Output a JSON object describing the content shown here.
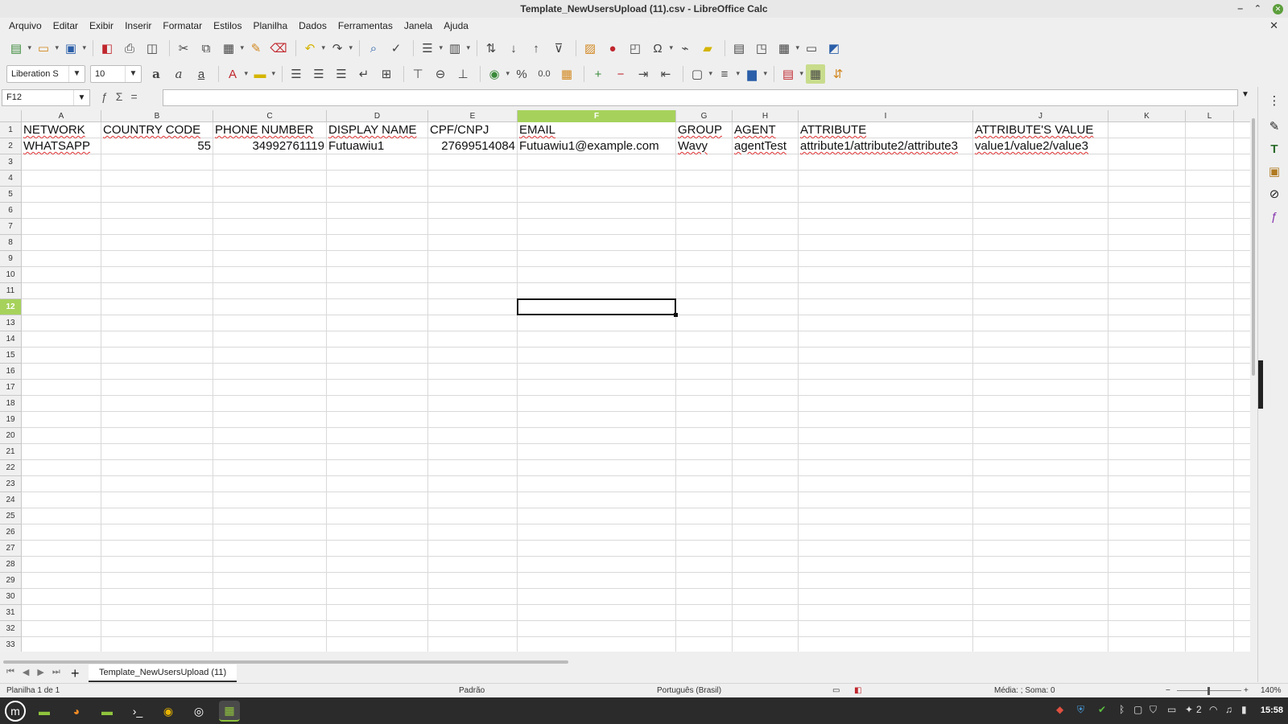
{
  "window": {
    "title": "Template_NewUsersUpload (11).csv - LibreOffice Calc",
    "min_label": "‒",
    "max_label": "⌃",
    "close_label": "✕",
    "doc_close_label": "✕"
  },
  "menu": [
    "Arquivo",
    "Editar",
    "Exibir",
    "Inserir",
    "Formatar",
    "Estilos",
    "Planilha",
    "Dados",
    "Ferramentas",
    "Janela",
    "Ajuda"
  ],
  "toolbar": {
    "font_name": "Liberation S",
    "font_size": "10",
    "percent_label": "%",
    "decimal_label": "0.0",
    "omega_label": "Ω"
  },
  "formula_bar": {
    "name_box": "F12",
    "sum_label": "Σ",
    "equals_label": "=",
    "content": ""
  },
  "grid": {
    "columns": [
      "A",
      "B",
      "C",
      "D",
      "E",
      "F",
      "G",
      "H",
      "I",
      "J",
      "K",
      "L"
    ],
    "selected_column": "F",
    "selected_row": "12",
    "rows": [
      "1",
      "2",
      "3",
      "4",
      "5",
      "6",
      "7",
      "8",
      "9",
      "10",
      "11",
      "12",
      "13",
      "14",
      "15",
      "16",
      "17",
      "18",
      "19",
      "20",
      "21",
      "22",
      "23",
      "24",
      "25",
      "26",
      "27",
      "28",
      "29",
      "30",
      "31",
      "32",
      "33"
    ],
    "header_row": [
      "NETWORK",
      "COUNTRY CODE",
      "PHONE NUMBER",
      "DISPLAY NAME",
      "CPF/CNPJ",
      "EMAIL",
      "GROUP",
      "AGENT",
      "ATTRIBUTE",
      "ATTRIBUTE'S VALUE"
    ],
    "data_row": [
      "WHATSAPP",
      "55",
      "34992761119",
      "Futuawiu1",
      "27699514084",
      "Futuawiu1@example.com",
      "Wavy",
      "agentTest",
      "attribute1/attribute2/attribute3",
      "value1/value2/value3"
    ]
  },
  "sheets": {
    "add_label": "+",
    "active_tab": "Template_NewUsersUpload (11)"
  },
  "status": {
    "sheet_info": "Planilha 1 de 1",
    "page_style": "Padrão",
    "language": "Português (Brasil)",
    "summary": "Média: ; Soma: 0",
    "zoom": "140%"
  },
  "taskbar": {
    "clock": "15:58",
    "workspace": "2"
  },
  "colors": {
    "selection_header": "#a6d25b",
    "spell_error": "#e03030"
  }
}
